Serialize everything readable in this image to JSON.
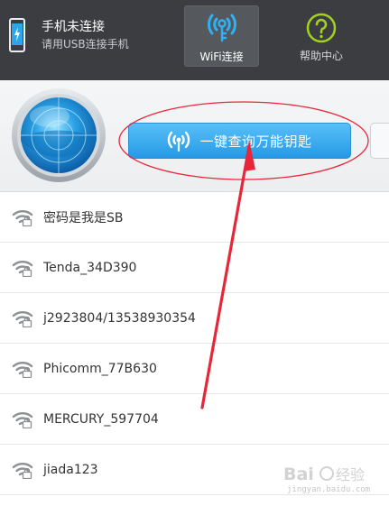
{
  "device": {
    "title": "手机未连接",
    "subtitle": "请用USB连接手机",
    "icon": "phone-icon"
  },
  "tabs": {
    "wifi": {
      "label": "WiFi连接",
      "icon": "wifi-key-icon",
      "active": true
    },
    "help": {
      "label": "帮助中心",
      "icon": "help-icon"
    }
  },
  "action": {
    "query_label": "一键查询万能钥匙",
    "query_icon": "wifi-signal-icon",
    "radar_icon": "radar-icon"
  },
  "wifi_networks": [
    {
      "name": "密码是我是SB"
    },
    {
      "name": "Tenda_34D390"
    },
    {
      "name": "j2923804/13538930354"
    },
    {
      "name": "Phicomm_77B630"
    },
    {
      "name": "MERCURY_597704"
    },
    {
      "name": "jiada123"
    }
  ],
  "colors": {
    "topbar": "#3b3d41",
    "accent_blue": "#2699e6",
    "annotation_red": "#e8263a",
    "help_green": "#a3d21c"
  },
  "watermark": {
    "text": "jingyan.baidu.com"
  }
}
